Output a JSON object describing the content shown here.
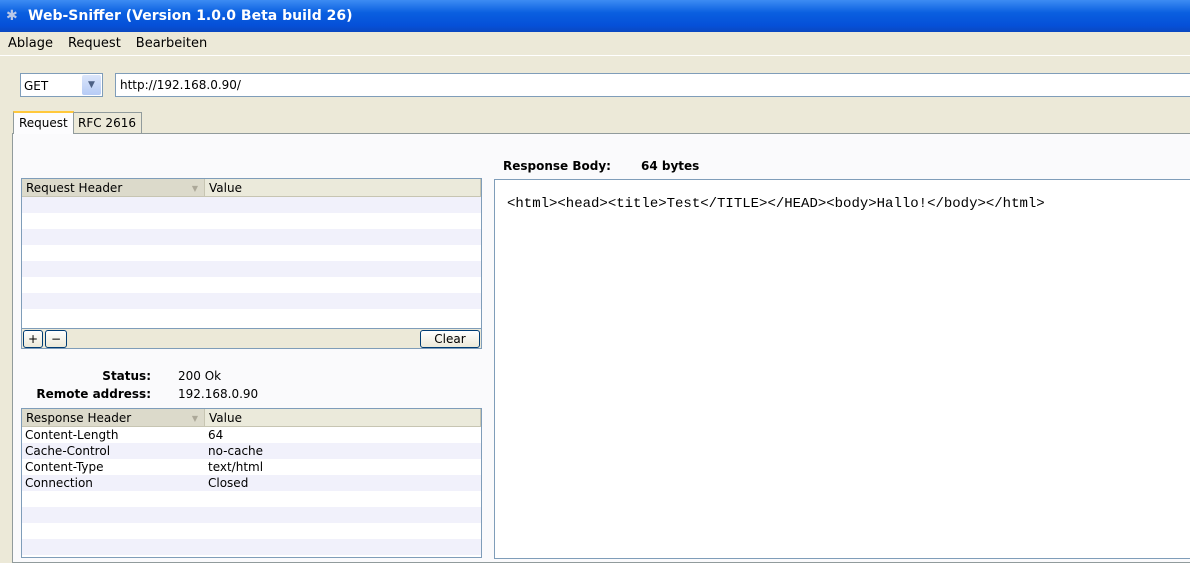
{
  "window": {
    "title": "Web-Sniffer (Version 1.0.0 Beta build 26)"
  },
  "menu": [
    "Ablage",
    "Request",
    "Bearbeiten"
  ],
  "toolbar": {
    "method": "GET",
    "url": "http://192.168.0.90/"
  },
  "tabs": [
    "Request",
    "RFC 2616"
  ],
  "request_table": {
    "headers": [
      "Request Header",
      "Value"
    ],
    "add": "+",
    "remove": "−",
    "clear": "Clear"
  },
  "status": {
    "status_label": "Status:",
    "status_value": "200 Ok",
    "remote_label": "Remote address:",
    "remote_value": "192.168.0.90"
  },
  "response_table": {
    "headers": [
      "Response Header",
      "Value"
    ],
    "rows": [
      [
        "Content-Length",
        "64"
      ],
      [
        "Cache-Control",
        "no-cache"
      ],
      [
        "Content-Type",
        "text/html"
      ],
      [
        "Connection",
        "Closed"
      ]
    ]
  },
  "response_body": {
    "label": "Response Body:",
    "size": "64 bytes",
    "content": "<html><head><title>Test</TITLE></HEAD><body>Hallo!</body></html>"
  }
}
